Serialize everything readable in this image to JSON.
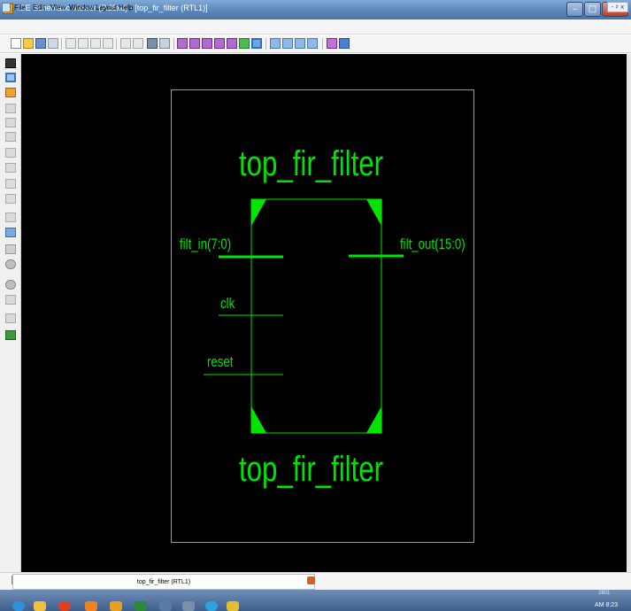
{
  "window": {
    "title": "ISE Schematic Viewer (P.28xd) - [top_fir_filter (RTL1)]",
    "controls": {
      "minimize": "–",
      "maximize": "□",
      "close": "x"
    }
  },
  "menu": {
    "items": [
      "File",
      "Edit",
      "View",
      "Window",
      "Layout",
      "Help"
    ],
    "mdi_controls": "- ♯ x"
  },
  "schematic": {
    "module_name_top": "top_fir_filter",
    "module_name_bottom": "top_fir_filter",
    "pins": {
      "input_data": "filt_in(7:0)",
      "clock": "clk",
      "reset": "reset",
      "output_data": "filt_out(15:0)"
    },
    "colors": {
      "canvas": "#000000",
      "symbol": "#00e400",
      "frame": "#9a9a9a"
    }
  },
  "tabs": {
    "active": "top_fir_filter (RTL1)"
  },
  "taskbar": {
    "clock_top": "2801",
    "clock_bottom": "AM 8:23"
  },
  "icons": [
    "app-icon",
    "document-icon",
    "new-icon",
    "open-icon",
    "save-icon",
    "cut-icon",
    "copy-icon",
    "paste-icon",
    "delete-icon",
    "undo-icon",
    "redo-icon",
    "find-icon",
    "zoom-icon",
    "select-icon",
    "pan-icon",
    "close-tab-icon"
  ]
}
